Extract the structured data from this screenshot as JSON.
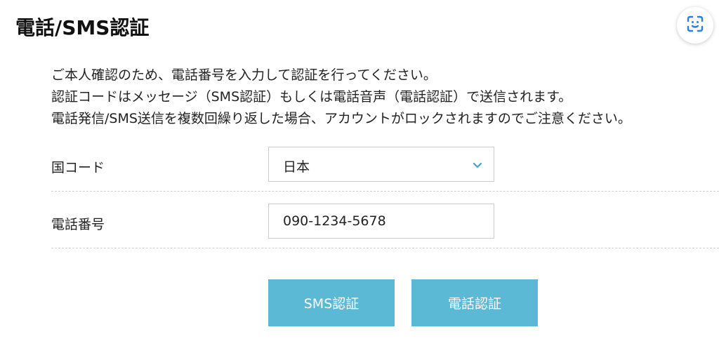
{
  "header": {
    "title": "電話/SMS認証"
  },
  "icons": {
    "scan": "scan-text-icon",
    "chevron": "chevron-down-icon"
  },
  "intro": {
    "lines": [
      "ご本人確認のため、電話番号を入力して認証を行ってください。",
      "認証コードはメッセージ（SMS認証）もしくは電話音声（電話認証）で送信されます。",
      "電話発信/SMS送信を複数回繰り返した場合、アカウントがロックされますのでご注意ください。"
    ]
  },
  "form": {
    "country": {
      "label": "国コード",
      "selected": "日本"
    },
    "phone": {
      "label": "電話番号",
      "value": "090-1234-5678"
    }
  },
  "actions": {
    "sms_label": "SMS認証",
    "call_label": "電話認証"
  },
  "colors": {
    "accent": "#5bb9d6",
    "chevron": "#3aa6cc",
    "scan_icon": "#2b7de9"
  }
}
